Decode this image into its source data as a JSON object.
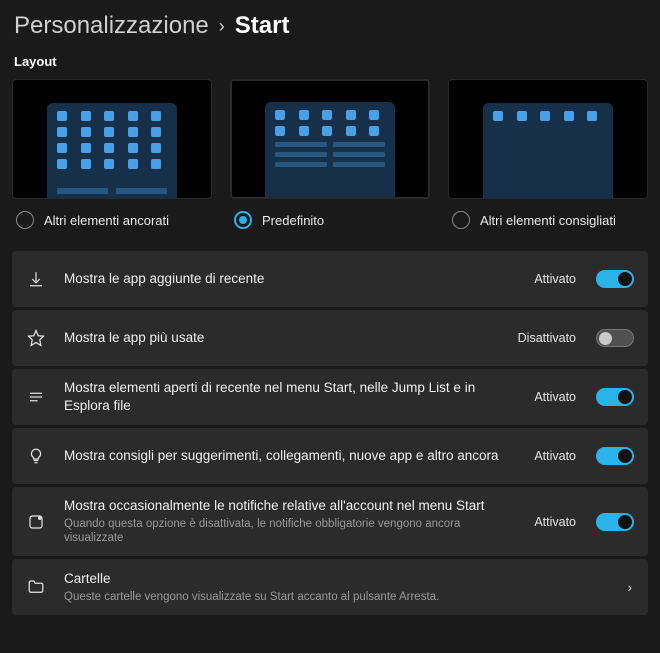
{
  "breadcrumb": {
    "parent": "Personalizzazione",
    "current": "Start"
  },
  "section_label": "Layout",
  "layout_options": [
    {
      "label": "Altri elementi ancorati",
      "selected": false
    },
    {
      "label": "Predefinito",
      "selected": true
    },
    {
      "label": "Altri elementi consigliati",
      "selected": false
    }
  ],
  "state_labels": {
    "on": "Attivato",
    "off": "Disattivato"
  },
  "settings": [
    {
      "icon": "download-icon",
      "title": "Mostra le app aggiunte di recente",
      "sub": "",
      "state": "on",
      "type": "toggle"
    },
    {
      "icon": "star-icon",
      "title": "Mostra le app più usate",
      "sub": "",
      "state": "off",
      "type": "toggle"
    },
    {
      "icon": "list-icon",
      "title": "Mostra elementi aperti di recente nel menu Start, nelle Jump List e in Esplora file",
      "sub": "",
      "state": "on",
      "type": "toggle"
    },
    {
      "icon": "bulb-icon",
      "title": "Mostra consigli per suggerimenti, collegamenti, nuove app e altro ancora",
      "sub": "",
      "state": "on",
      "type": "toggle"
    },
    {
      "icon": "notify-icon",
      "title": "Mostra occasionalmente le notifiche relative all'account nel menu Start",
      "sub": "Quando questa opzione è disattivata, le notifiche obbligatorie vengono ancora visualizzate",
      "state": "on",
      "type": "toggle"
    },
    {
      "icon": "folder-icon",
      "title": "Cartelle",
      "sub": "Queste cartelle vengono visualizzate su Start accanto al pulsante Arresta.",
      "state": "",
      "type": "nav"
    }
  ]
}
